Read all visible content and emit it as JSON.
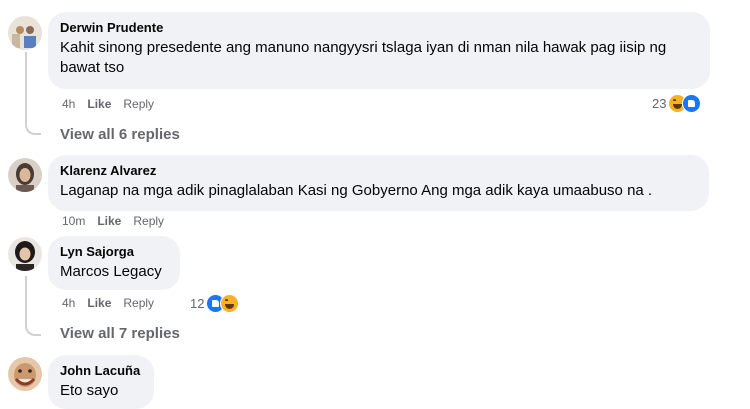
{
  "comments": [
    {
      "author": "Derwin Prudente",
      "text": "Kahit sinong presedente ang manuno nangyysri tslaga iyan di nman nila hawak pag iisip ng bawat tso",
      "time": "4h",
      "like": "Like",
      "reply": "Reply",
      "reaction_count": "23",
      "reactions": [
        "haha-icon",
        "like-icon"
      ],
      "view_replies": "View all 6 replies"
    },
    {
      "author": "Klarenz Alvarez",
      "text": "Laganap na mga adik pinaglalaban Kasi ng Gobyerno Ang mga adik kaya umaabuso na .",
      "time": "10m",
      "like": "Like",
      "reply": "Reply"
    },
    {
      "author": "Lyn Sajorga",
      "text": "Marcos Legacy",
      "time": "4h",
      "like": "Like",
      "reply": "Reply",
      "reaction_count": "12",
      "reactions": [
        "like-icon",
        "haha-icon"
      ],
      "view_replies": "View all 7 replies"
    },
    {
      "author": "John Lacuña",
      "text": "Eto sayo"
    }
  ]
}
